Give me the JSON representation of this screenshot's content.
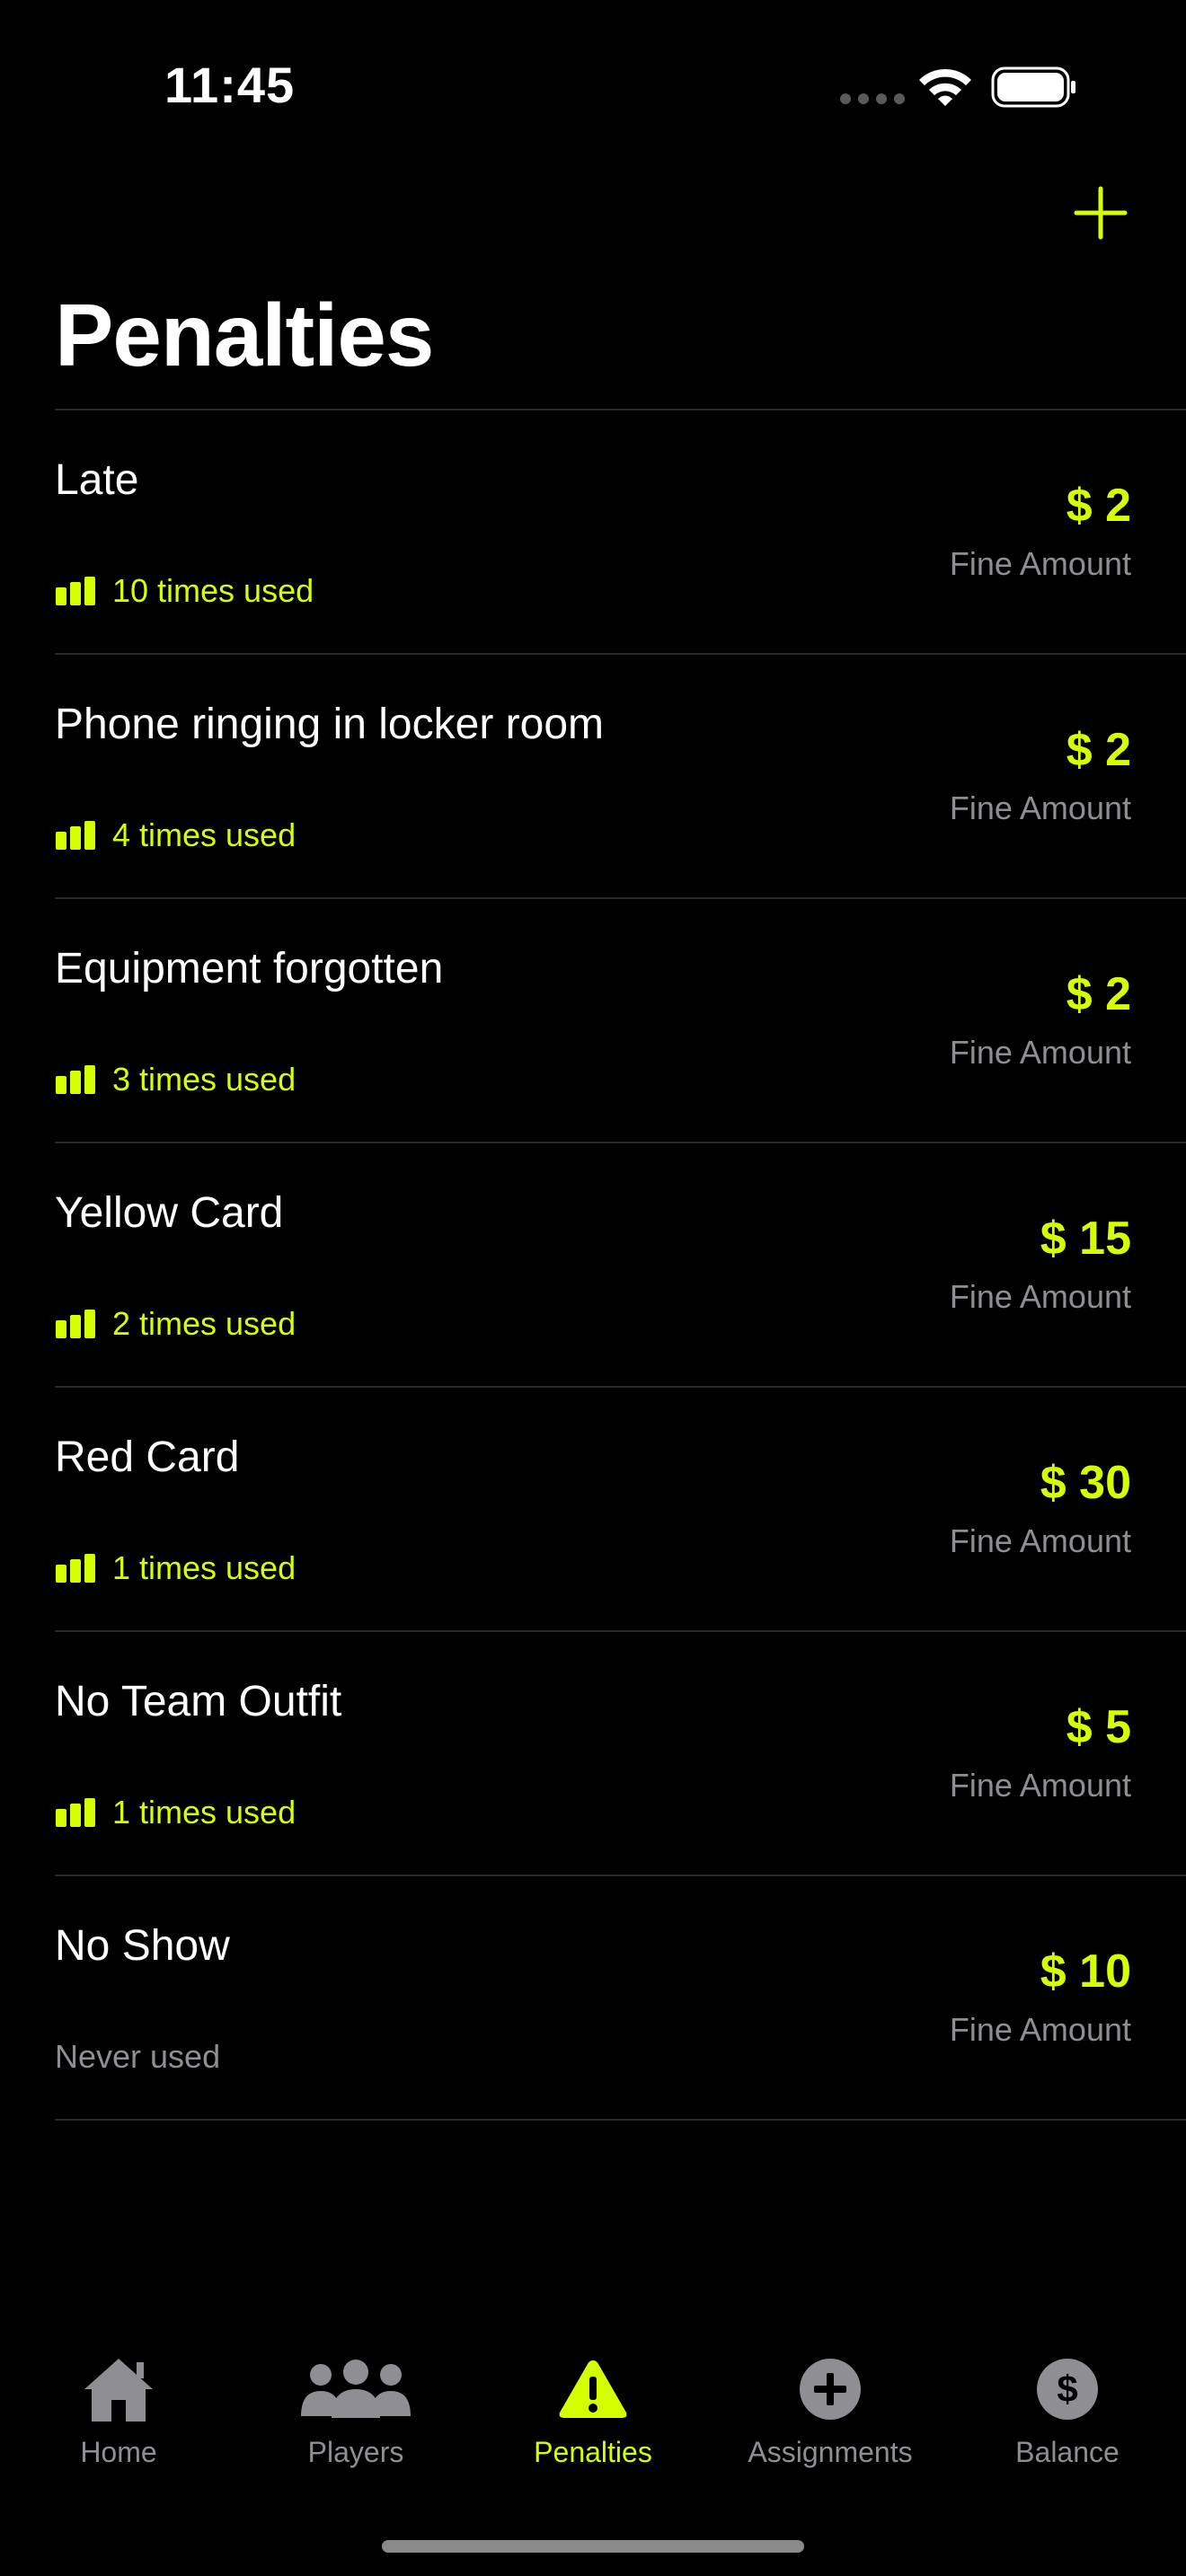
{
  "status_bar": {
    "time": "11:45"
  },
  "header": {
    "title": "Penalties",
    "add_icon": "plus-icon"
  },
  "colors": {
    "accent": "#d4ff00",
    "secondary_text": "#8e8e93",
    "background": "#000000",
    "divider": "#262626"
  },
  "penalties": [
    {
      "name": "Late",
      "usage": "10 times used",
      "used": true,
      "amount": "$ 2",
      "amount_label": "Fine Amount"
    },
    {
      "name": "Phone ringing in locker room",
      "usage": "4 times used",
      "used": true,
      "amount": "$ 2",
      "amount_label": "Fine Amount"
    },
    {
      "name": "Equipment forgotten",
      "usage": "3 times used",
      "used": true,
      "amount": "$ 2",
      "amount_label": "Fine Amount"
    },
    {
      "name": "Yellow Card",
      "usage": "2 times used",
      "used": true,
      "amount": "$ 15",
      "amount_label": "Fine Amount"
    },
    {
      "name": "Red Card",
      "usage": "1 times used",
      "used": true,
      "amount": "$ 30",
      "amount_label": "Fine Amount"
    },
    {
      "name": "No Team Outfit",
      "usage": "1 times used",
      "used": true,
      "amount": "$ 5",
      "amount_label": "Fine Amount"
    },
    {
      "name": "No Show",
      "usage": "Never used",
      "used": false,
      "amount": "$ 10",
      "amount_label": "Fine Amount"
    }
  ],
  "tab_bar": {
    "tabs": [
      {
        "label": "Home",
        "icon": "house-icon",
        "active": false
      },
      {
        "label": "Players",
        "icon": "people-icon",
        "active": false
      },
      {
        "label": "Penalties",
        "icon": "warning-triangle-icon",
        "active": true
      },
      {
        "label": "Assignments",
        "icon": "plus-circle-icon",
        "active": false
      },
      {
        "label": "Balance",
        "icon": "dollar-circle-icon",
        "active": false
      }
    ]
  }
}
